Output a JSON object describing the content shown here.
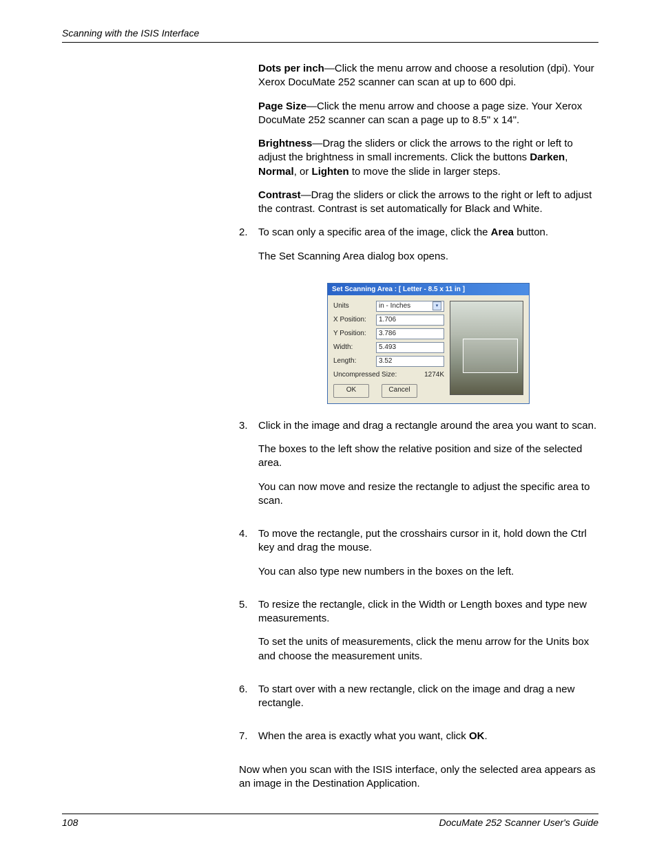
{
  "header": {
    "breadcrumb": "Scanning with the ISIS Interface"
  },
  "intro": {
    "dpi_bold": "Dots per inch",
    "dpi_text": "—Click the menu arrow and choose a resolution (dpi). Your Xerox DocuMate 252 scanner can scan at up to 600 dpi.",
    "pagesize_bold": "Page Size",
    "pagesize_text": "—Click the menu arrow and choose a page size. Your Xerox DocuMate 252 scanner can scan a page up to 8.5\" x 14\".",
    "brightness_bold": "Brightness",
    "brightness_text1": "—Drag the sliders or click the arrows to the right or left to adjust the brightness in small increments. Click the buttons ",
    "darken": "Darken",
    "normal": "Normal",
    "lighten": "Lighten",
    "brightness_text2": " to move the slide in larger steps.",
    "contrast_bold": "Contrast",
    "contrast_text": "—Drag the sliders or click the arrows to the right or left to adjust the contrast. Contrast is set automatically for Black and White."
  },
  "steps": {
    "s2": {
      "num": "2.",
      "text1": "To scan only a specific area of the image, click the ",
      "area_bold": "Area",
      "text2": " button.",
      "after": "The Set Scanning Area dialog box opens."
    },
    "s3": {
      "num": "3.",
      "text": "Click in the image and drag a rectangle around the area you want to scan.",
      "p2": "The boxes to the left show the relative position and size of the selected area.",
      "p3": "You can now move and resize the rectangle to adjust the specific area to scan."
    },
    "s4": {
      "num": "4.",
      "text": "To move the rectangle, put the crosshairs cursor in it, hold down the Ctrl key and drag the mouse.",
      "p2": "You can also type new numbers in the boxes on the left."
    },
    "s5": {
      "num": "5.",
      "text": "To resize the rectangle, click in the Width or Length boxes and type new measurements.",
      "p2": "To set the units of measurements, click the menu arrow for the Units box and choose the measurement units."
    },
    "s6": {
      "num": "6.",
      "text": "To start over with a new rectangle, click on the image and drag a new rectangle."
    },
    "s7": {
      "num": "7.",
      "text1": "When the area is exactly what you want, click ",
      "ok_bold": "OK",
      "text2": "."
    },
    "closing": "Now when you scan with the ISIS interface, only the selected area appears as an image in the Destination Application."
  },
  "dialog": {
    "title": "Set Scanning Area  :  [ Letter - 8.5 x 11 in ]",
    "units_label": "Units",
    "units_value": "in - Inches",
    "xpos_label": "X Position:",
    "xpos_value": "1.706",
    "ypos_label": "Y Position:",
    "ypos_value": "3.786",
    "width_label": "Width:",
    "width_value": "5.493",
    "length_label": "Length:",
    "length_value": "3.52",
    "size_label": "Uncompressed Size:",
    "size_value": "1274K",
    "ok": "OK",
    "cancel": "Cancel"
  },
  "footer": {
    "page": "108",
    "title": "DocuMate 252 Scanner User's Guide"
  },
  "sep": {
    "comma_or": ", or ",
    "comma": ", "
  }
}
